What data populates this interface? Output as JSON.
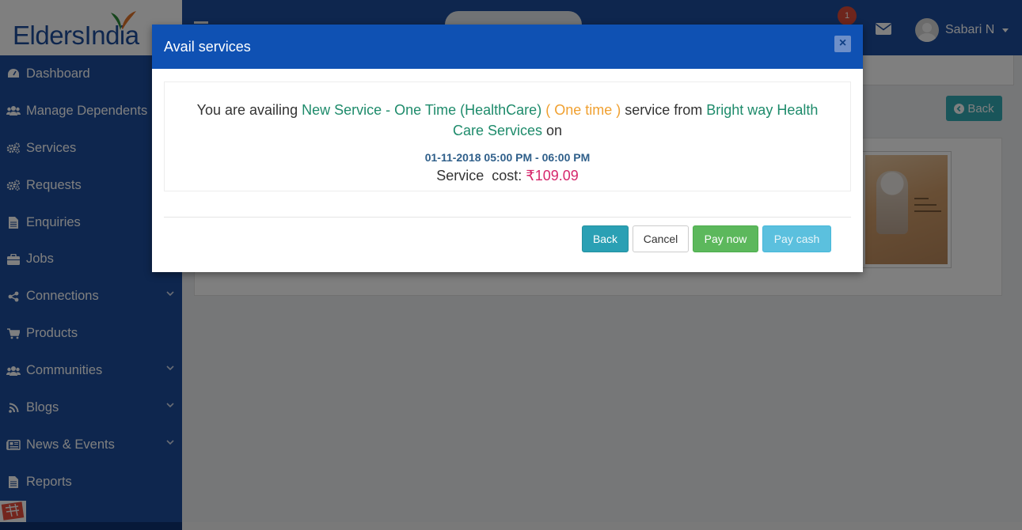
{
  "brand": {
    "logo_part1": "Elders",
    "logo_part2": "India"
  },
  "sidebar": {
    "items": [
      {
        "label": "Dashboard",
        "icon": "dashboard-icon",
        "expandable": false
      },
      {
        "label": "Manage Dependents",
        "icon": "users-icon",
        "expandable": false
      },
      {
        "label": "Services",
        "icon": "gears-icon",
        "expandable": false
      },
      {
        "label": "Requests",
        "icon": "gears-icon",
        "expandable": false
      },
      {
        "label": "Enquiries",
        "icon": "document-icon",
        "expandable": false
      },
      {
        "label": "Jobs",
        "icon": "briefcase-icon",
        "expandable": false
      },
      {
        "label": "Connections",
        "icon": "share-icon",
        "expandable": true
      },
      {
        "label": "Products",
        "icon": "cart-icon",
        "expandable": false
      },
      {
        "label": "Communities",
        "icon": "users-icon",
        "expandable": true
      },
      {
        "label": "Blogs",
        "icon": "rss-icon",
        "expandable": true
      },
      {
        "label": "News & Events",
        "icon": "newspaper-icon",
        "expandable": true
      },
      {
        "label": "Reports",
        "icon": "document-icon",
        "expandable": false
      }
    ]
  },
  "header": {
    "notification_count": "1",
    "user_name": "Sabari N"
  },
  "content": {
    "back_label": "Back"
  },
  "modal": {
    "title": "Avail services",
    "close_label": "×",
    "prefix": "You are availing",
    "service_name": "New Service - One Time (HealthCare)",
    "frequency": "( One time )",
    "middle": "service from",
    "provider": "Bright way Health Care Services",
    "suffix": "on",
    "datetime": "01-11-2018 05:00 PM - 06:00 PM",
    "cost_label": "Service  cost:",
    "cost_value": "₹109.09",
    "buttons": {
      "back": "Back",
      "cancel": "Cancel",
      "pay_now": "Pay now",
      "pay_cash": "Pay cash"
    }
  },
  "colors": {
    "sidebar_bg": "#1d4d9c",
    "modal_header_bg": "#0f51b3",
    "teal_text": "#1e8b6b",
    "orange_text": "#f0a030",
    "cost_text": "#d6276c",
    "pay_now_bg": "#5cb85c",
    "pay_cash_bg": "#5bc0de",
    "back_bg": "#2aa0b4"
  }
}
